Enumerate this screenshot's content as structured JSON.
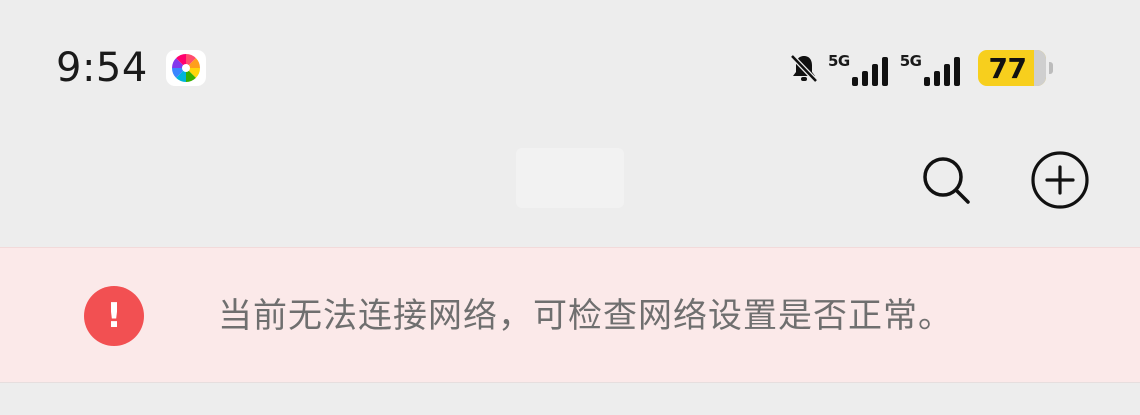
{
  "status_bar": {
    "time": "9:54",
    "app_notification_icon": "colorful-pinwheel-icon",
    "mute_icon": "bell-muted-icon",
    "network_1": {
      "label": "5G",
      "signal_icon": "signal-bars-icon"
    },
    "network_2": {
      "label": "5G",
      "signal_icon": "signal-bars-icon"
    },
    "battery": {
      "level": "77",
      "color": "#f7cf1d",
      "icon": "battery-icon"
    }
  },
  "top_bar": {
    "search_icon": "search-icon",
    "add_icon": "add-circle-icon"
  },
  "network_banner": {
    "icon": "alert-circle-icon",
    "icon_glyph": "!",
    "icon_color": "#f25052",
    "background": "#fbe9e9",
    "message": "当前无法连接网络，可检查网络设置是否正常。"
  }
}
